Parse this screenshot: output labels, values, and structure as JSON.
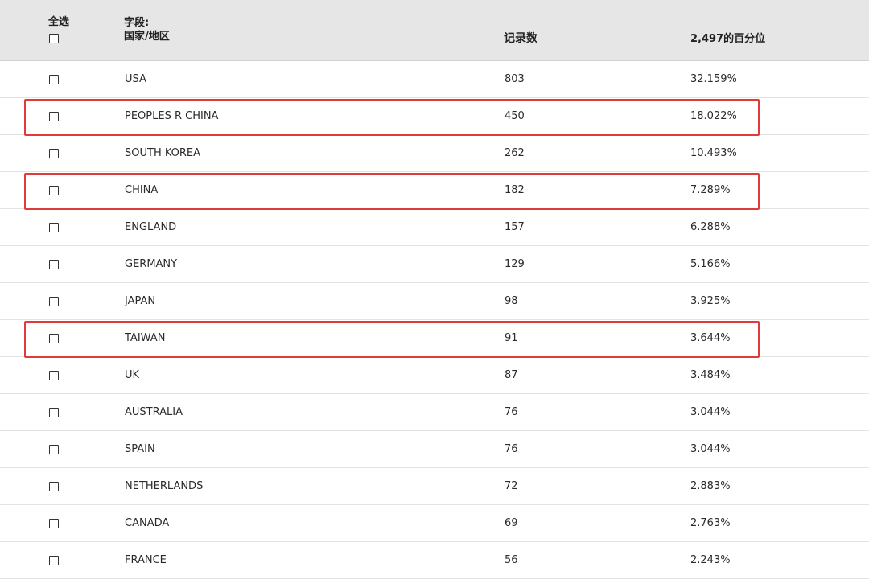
{
  "header": {
    "select_all_label": "全选",
    "field_label_line1": "字段:",
    "field_label_line2": "国家/地区",
    "count_label": "记录数",
    "percent_label": "2,497的百分位"
  },
  "rows": [
    {
      "name": "USA",
      "count": "803",
      "percent": "32.159%",
      "highlighted": false
    },
    {
      "name": "PEOPLES R CHINA",
      "count": "450",
      "percent": "18.022%",
      "highlighted": true
    },
    {
      "name": "SOUTH KOREA",
      "count": "262",
      "percent": "10.493%",
      "highlighted": false
    },
    {
      "name": "CHINA",
      "count": "182",
      "percent": "7.289%",
      "highlighted": true
    },
    {
      "name": "ENGLAND",
      "count": "157",
      "percent": "6.288%",
      "highlighted": false
    },
    {
      "name": "GERMANY",
      "count": "129",
      "percent": "5.166%",
      "highlighted": false
    },
    {
      "name": "JAPAN",
      "count": "98",
      "percent": "3.925%",
      "highlighted": false
    },
    {
      "name": "TAIWAN",
      "count": "91",
      "percent": "3.644%",
      "highlighted": true
    },
    {
      "name": "UK",
      "count": "87",
      "percent": "3.484%",
      "highlighted": false
    },
    {
      "name": "AUSTRALIA",
      "count": "76",
      "percent": "3.044%",
      "highlighted": false
    },
    {
      "name": "SPAIN",
      "count": "76",
      "percent": "3.044%",
      "highlighted": false
    },
    {
      "name": "NETHERLANDS",
      "count": "72",
      "percent": "2.883%",
      "highlighted": false
    },
    {
      "name": "CANADA",
      "count": "69",
      "percent": "2.763%",
      "highlighted": false
    },
    {
      "name": "FRANCE",
      "count": "56",
      "percent": "2.243%",
      "highlighted": false
    }
  ],
  "colors": {
    "header_bg": "#e6e6e6",
    "highlight_border": "#e03a3a",
    "row_divider": "#e3e3e3"
  }
}
